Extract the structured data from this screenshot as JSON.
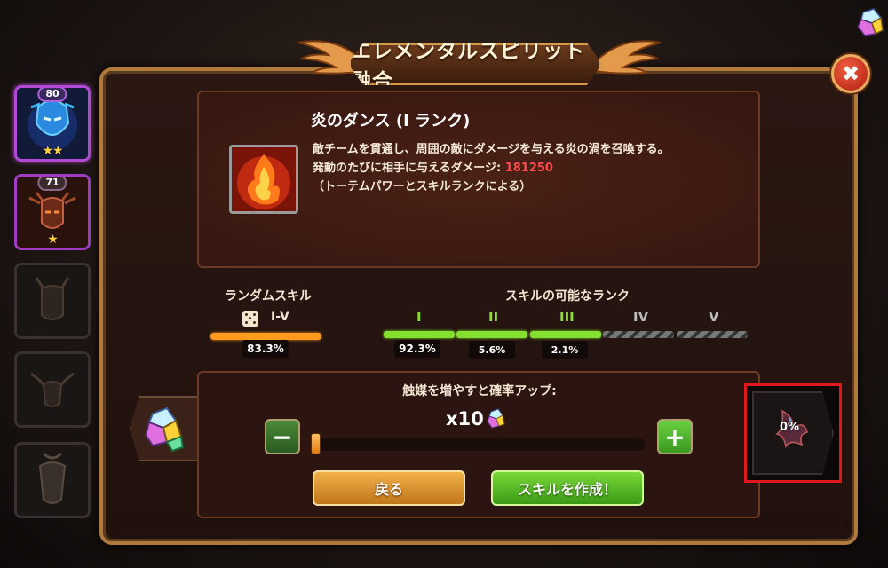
{
  "dialog": {
    "title": "エレメンタルスピリット融合"
  },
  "sidebar": {
    "totems": [
      {
        "level": "80",
        "stars": "★★",
        "state": "selected"
      },
      {
        "level": "71",
        "stars": "★",
        "state": "owned"
      },
      {
        "state": "locked"
      },
      {
        "state": "locked"
      },
      {
        "state": "locked"
      }
    ]
  },
  "skill": {
    "name": "炎のダンス (I ランク)",
    "desc_line1": "敵チームを貫通し、周囲の敵にダメージを与える炎の渦を召喚する。",
    "desc_line2_prefix": "発動のたびに相手に与えるダメージ: ",
    "damage": "181250",
    "desc_line3": "（トーテムパワーとスキルランクによる）"
  },
  "random_skill": {
    "heading": "ランダムスキル",
    "range": "I-V",
    "percent": "83.3%",
    "fill_fraction": 1.0
  },
  "ranks": {
    "heading": "スキルの可能なランク",
    "items": [
      {
        "label": "I",
        "percent": "92.3%",
        "active": true
      },
      {
        "label": "II",
        "percent": "5.6%",
        "active": true
      },
      {
        "label": "III",
        "percent": "2.1%",
        "active": true
      },
      {
        "label": "IV",
        "percent": "",
        "active": false
      },
      {
        "label": "V",
        "percent": "",
        "active": false
      }
    ]
  },
  "catalyst": {
    "label": "触媒を増やすと確率アップ:",
    "multiplier": "x10",
    "slider_fraction": 0.0,
    "minus_label": "−",
    "plus_label": "+"
  },
  "buttons": {
    "back": "戻る",
    "create": "スキルを作成！",
    "close": "✖"
  },
  "result": {
    "percent": "0%"
  },
  "colors": {
    "frame_gold": "#b07a3c",
    "green": "#84e030",
    "orange": "#ff9a1e",
    "damage_red": "#ff4a4a",
    "highlight_red": "#e0181c"
  }
}
